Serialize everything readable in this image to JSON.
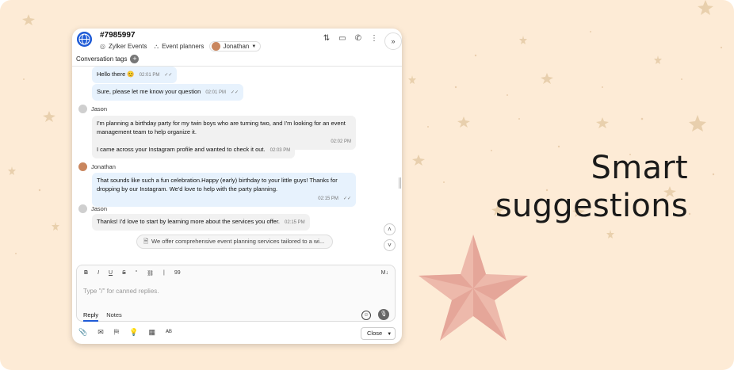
{
  "banner": {
    "headline_line1": "Smart",
    "headline_line2": "suggestions",
    "background": "#fdebd6",
    "star_color": "#e8a39a"
  },
  "chat": {
    "ticket_id": "#7985997",
    "department": "Zylker Events",
    "team": "Event planners",
    "agent": "Jonathan",
    "conversation_tags_label": "Conversation tags",
    "messages": [
      {
        "direction": "out",
        "text": "Hello there 😊",
        "time": "02:01 PM"
      },
      {
        "direction": "out",
        "text": "Sure, please let me know your question",
        "time": "02:01 PM"
      },
      {
        "sender": "Jason"
      },
      {
        "direction": "in",
        "text": "I'm planning a birthday party for my twin boys who are turning two, and I'm looking for an event management team to help organize it.",
        "time": "02:02 PM"
      },
      {
        "direction": "in",
        "text": "I came across your Instagram profile and wanted to check it out.",
        "time": "02:03 PM"
      },
      {
        "sender": "Jonathan"
      },
      {
        "direction": "out",
        "text": "That sounds like such a fun celebration.Happy (early) birthday to your little guys! Thanks for dropping by our Instagram. We'd love to help with the party planning.",
        "time": "02:15 PM"
      },
      {
        "sender": "Jason"
      },
      {
        "direction": "in",
        "text": "Thanks! I'd love to start by learning more about the services you offer.",
        "time": "02:15 PM"
      }
    ],
    "suggestion": "We offer comprehensive event planning services tailored to a wi...",
    "composer": {
      "placeholder": "Type \"/\" for canned replies.",
      "tab_reply": "Reply",
      "tab_notes": "Notes",
      "format_bold": "B",
      "format_italic": "I",
      "format_underline": "U",
      "format_strike": "S",
      "format_quote": "“",
      "format_link": "🔗",
      "format_code": "99",
      "markdown": "M↓"
    },
    "close_label": "Close"
  }
}
